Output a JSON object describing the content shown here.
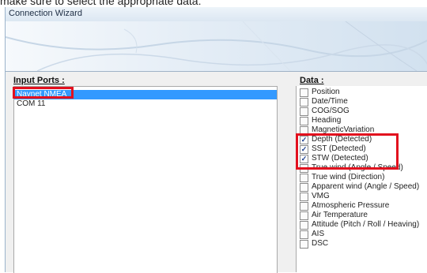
{
  "caption": "make sure to select the appropriate data:",
  "window": {
    "title": "Connection Wizard"
  },
  "input_ports": {
    "label": "Input Ports :",
    "items": [
      {
        "label": "Navnet NMEA",
        "selected": true
      },
      {
        "label": "COM 11",
        "selected": false
      }
    ]
  },
  "data_panel": {
    "label": "Data :",
    "items": [
      {
        "label": "Position",
        "checked": false
      },
      {
        "label": "Date/Time",
        "checked": false
      },
      {
        "label": "COG/SOG",
        "checked": false
      },
      {
        "label": "Heading",
        "checked": false
      },
      {
        "label": "MagneticVariation",
        "checked": false
      },
      {
        "label": "Depth (Detected)",
        "checked": true
      },
      {
        "label": "SST (Detected)",
        "checked": true
      },
      {
        "label": "STW (Detected)",
        "checked": true
      },
      {
        "label": "True wind (Angle / Speed)",
        "checked": false
      },
      {
        "label": "True wind (Direction)",
        "checked": false
      },
      {
        "label": "Apparent wind (Angle / Speed)",
        "checked": false
      },
      {
        "label": "VMG",
        "checked": false
      },
      {
        "label": "Atmospheric Pressure",
        "checked": false
      },
      {
        "label": "Air Temperature",
        "checked": false
      },
      {
        "label": "Attitude (Pitch / Roll / Heaving)",
        "checked": false
      },
      {
        "label": "AIS",
        "checked": false
      },
      {
        "label": "DSC",
        "checked": false
      }
    ]
  },
  "colors": {
    "highlight": "#e2101e",
    "selection": "#3399ff"
  }
}
